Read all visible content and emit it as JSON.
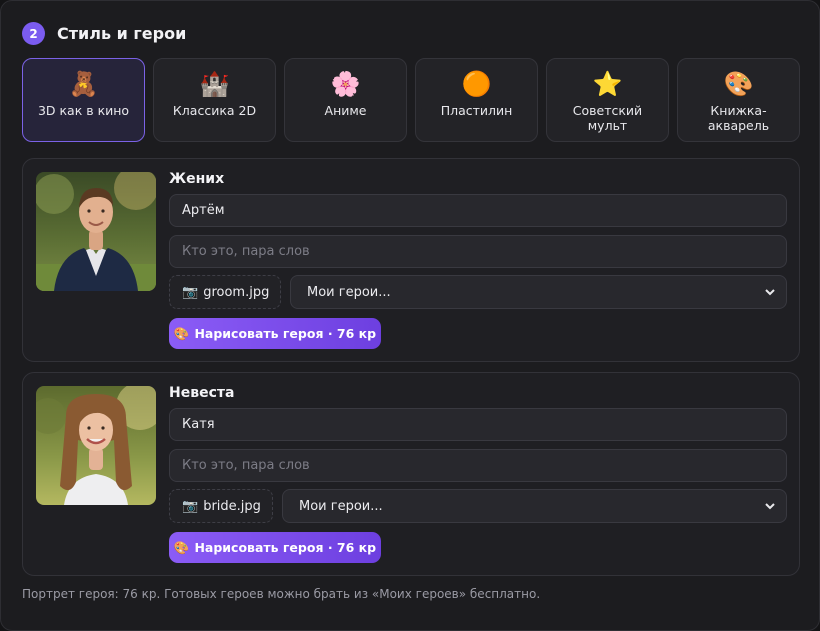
{
  "section": {
    "step": "2",
    "title": "Стиль и герои"
  },
  "styles": [
    {
      "emoji": "🧸",
      "label": "3D как в кино",
      "active": true
    },
    {
      "emoji": "🏰",
      "label": "Классика 2D",
      "active": false
    },
    {
      "emoji": "🌸",
      "label": "Аниме",
      "active": false
    },
    {
      "emoji": "🟠",
      "label": "Пластилин",
      "active": false
    },
    {
      "emoji": "⭐",
      "label": "Советский\nмульт",
      "active": false
    },
    {
      "emoji": "🎨",
      "label": "Книжка-\nакварель",
      "active": false
    }
  ],
  "heroes": [
    {
      "role": "Жених",
      "name_value": "Артём",
      "desc_placeholder": "Кто это, пара слов",
      "file_icon": "📷",
      "file_name": "groom.jpg",
      "select_value": "Мои герои...",
      "draw_icon": "🎨",
      "draw_label": "Нарисовать героя · 76 кр"
    },
    {
      "role": "Невеста",
      "name_value": "Катя",
      "desc_placeholder": "Кто это, пара слов",
      "file_icon": "📷",
      "file_name": "bride.jpg",
      "select_value": "Мои герои...",
      "draw_icon": "🎨",
      "draw_label": "Нарисовать героя · 76 кр"
    }
  ],
  "footer_note": "Портрет героя: 76 кр. Готовых героев можно брать из «Моих героев» бесплатно.",
  "colors": {
    "accent": "#7b5cf0",
    "background": "#1c1c1f"
  }
}
